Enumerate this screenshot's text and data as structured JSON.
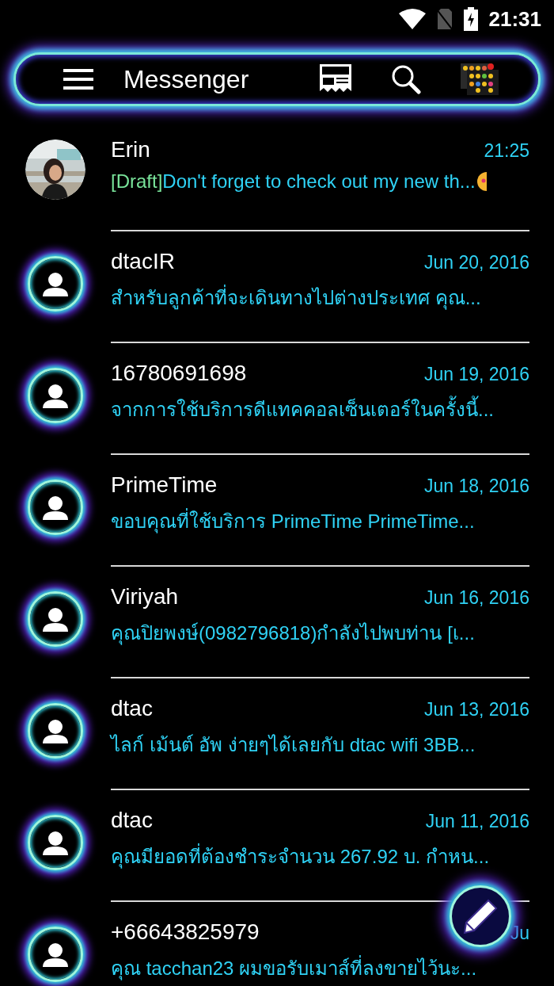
{
  "status_bar": {
    "time": "21:31"
  },
  "toolbar": {
    "title": "Messenger"
  },
  "conversations": [
    {
      "name": "Erin",
      "date": "21:25",
      "draft_label": "[Draft]",
      "preview": "Don't forget to check out my new th...",
      "trailing_emoji": true
    },
    {
      "name": "dtacIR",
      "date": "Jun 20, 2016",
      "kind": "contact",
      "preview": "สำหรับลูกค้าที่จะเดินทางไปต่างประเทศ คุณ..."
    },
    {
      "name": "16780691698",
      "date": "Jun 19, 2016",
      "kind": "contact",
      "preview": "จากการใช้บริการดีแทคคอลเซ็นเตอร์ในครั้งนี้..."
    },
    {
      "name": "PrimeTime",
      "date": "Jun 18, 2016",
      "kind": "contact",
      "preview": "ขอบคุณที่ใช้บริการ PrimeTime PrimeTime..."
    },
    {
      "name": "Viriyah",
      "date": "Jun 16, 2016",
      "kind": "contact",
      "preview": "คุณปิยพงษ์(0982796818)กำลังไปพบท่าน [เ..."
    },
    {
      "name": "dtac",
      "date": "Jun 13, 2016",
      "kind": "contact",
      "preview": "ไลก์ เม้นต์ อัพ ง่ายๆได้เลยกับ dtac wifi 3BB..."
    },
    {
      "name": "dtac",
      "date": "Jun 11, 2016",
      "kind": "contact",
      "preview": "คุณมียอดที่ต้องชำระจำนวน 267.92 บ. กำหน..."
    },
    {
      "name": "+66643825979",
      "date": "Ju",
      "kind": "contact",
      "preview": "คุณ tacchan23 ผมขอรับเมาส์ที่ลงขายไว้นะ..."
    }
  ]
}
